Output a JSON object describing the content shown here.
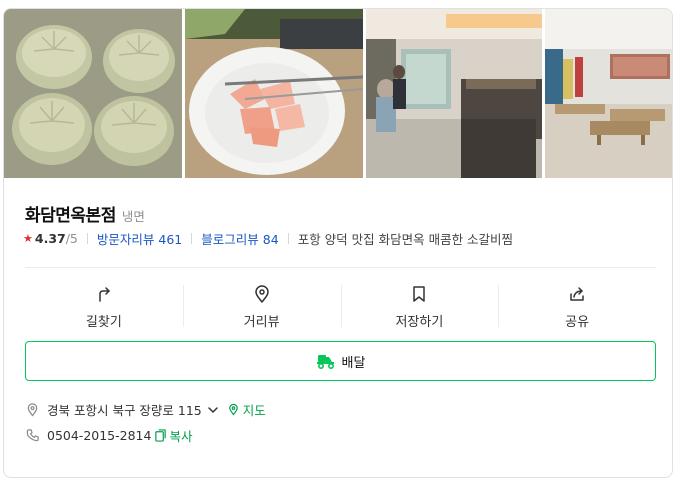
{
  "place": {
    "name": "화담면옥본점",
    "category": "냉면"
  },
  "rating": {
    "star_icon": "star-icon",
    "value": "4.37",
    "max": "/5"
  },
  "reviews": {
    "visitor_label": "방문자리뷰",
    "visitor_count": "461",
    "blog_label": "블로그리뷰",
    "blog_count": "84"
  },
  "description": "포항 양덕 맛집 화담면옥 매콤한 소갈비찜",
  "photos": [
    {
      "name": "dumplings-photo"
    },
    {
      "name": "pickled-radish-photo"
    },
    {
      "name": "restaurant-interior-photo"
    },
    {
      "name": "seating-room-photo"
    }
  ],
  "actions": [
    {
      "icon": "directions-icon",
      "label": "길찾기"
    },
    {
      "icon": "location-pin-icon",
      "label": "거리뷰"
    },
    {
      "icon": "bookmark-icon",
      "label": "저장하기"
    },
    {
      "icon": "share-icon",
      "label": "공유"
    }
  ],
  "delivery": {
    "icon": "delivery-scooter-icon",
    "label": "배달"
  },
  "address": {
    "icon": "location-pin-icon",
    "text": "경북 포항시 북구 장량로 115",
    "expand_icon": "chevron-down-icon",
    "map_label": "지도"
  },
  "phone": {
    "icon": "phone-icon",
    "number": "0504-2015-2814",
    "copy_label": "복사"
  },
  "colors": {
    "accent_green": "#03c75a",
    "link_blue": "#1a57c6",
    "star_red": "#e02d2d",
    "border": "#dfe1e5"
  }
}
